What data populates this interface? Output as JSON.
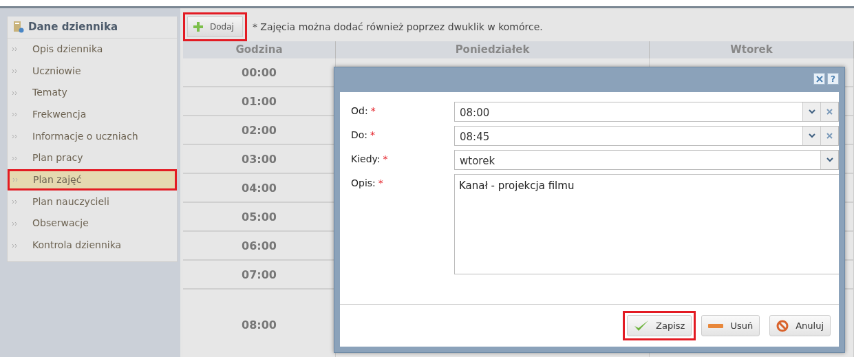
{
  "sidebar": {
    "title": "Dane dziennika",
    "items": [
      {
        "label": "Opis dziennika",
        "selected": false,
        "highlighted": false
      },
      {
        "label": "Uczniowie",
        "selected": false,
        "highlighted": false
      },
      {
        "label": "Tematy",
        "selected": false,
        "highlighted": false
      },
      {
        "label": "Frekwencja",
        "selected": false,
        "highlighted": false
      },
      {
        "label": "Informacje o uczniach",
        "selected": false,
        "highlighted": false
      },
      {
        "label": "Plan pracy",
        "selected": false,
        "highlighted": false
      },
      {
        "label": "Plan zajęć",
        "selected": true,
        "highlighted": true
      },
      {
        "label": "Plan nauczycieli",
        "selected": false,
        "highlighted": false
      },
      {
        "label": "Obserwacje",
        "selected": false,
        "highlighted": false
      },
      {
        "label": "Kontrola dziennika",
        "selected": false,
        "highlighted": false
      }
    ]
  },
  "toolbar": {
    "add_button": {
      "label": "Dodaj",
      "highlighted": true
    },
    "hint": "* Zajęcia można dodać również poprzez dwuklik w komórce."
  },
  "table": {
    "columns": [
      "Godzina",
      "Poniedziałek",
      "Wtorek"
    ],
    "rows": [
      "00:00",
      "01:00",
      "02:00",
      "03:00",
      "04:00",
      "05:00",
      "06:00",
      "07:00",
      "08:00"
    ]
  },
  "dialog": {
    "help": "?",
    "fields": [
      {
        "label": "Od:",
        "required_mark": "*",
        "kind": "combo",
        "value": "08:00",
        "clearable": true
      },
      {
        "label": "Do:",
        "required_mark": "*",
        "kind": "combo",
        "value": "08:45",
        "clearable": true
      },
      {
        "label": "Kiedy:",
        "required_mark": "*",
        "kind": "combo",
        "value": "wtorek",
        "clearable": false
      },
      {
        "label": "Opis:",
        "required_mark": "*",
        "kind": "textarea",
        "value": "Kanał - projekcja filmu"
      }
    ],
    "buttons": [
      {
        "label": "Zapisz",
        "kind": "save",
        "highlighted": true
      },
      {
        "label": "Usuń",
        "kind": "delete",
        "highlighted": false
      },
      {
        "label": "Anuluj",
        "kind": "cancel",
        "highlighted": false
      }
    ]
  }
}
